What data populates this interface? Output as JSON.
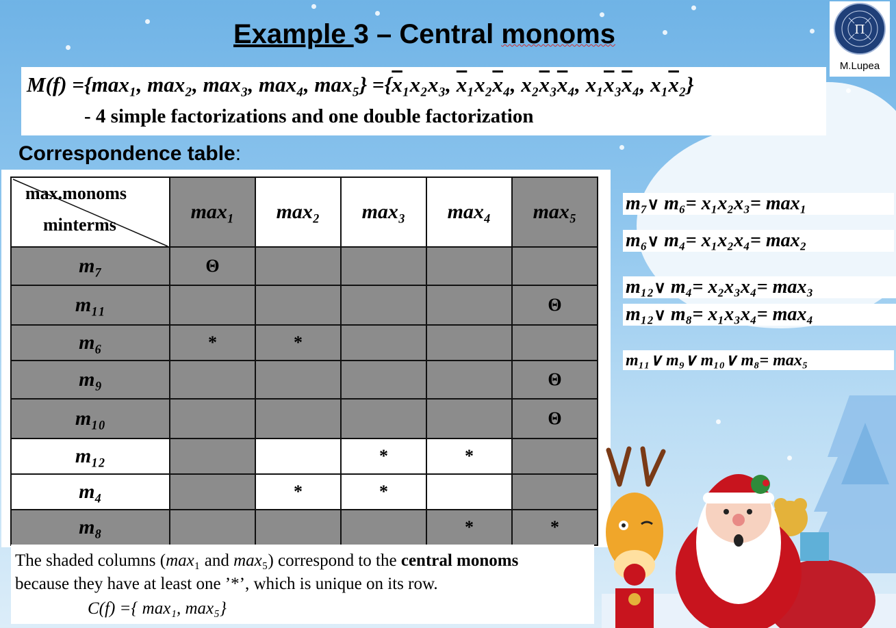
{
  "title": {
    "part1": "Example ",
    "part2": "3 – Central ",
    "part3": "monoms"
  },
  "logo": {
    "caption": "M.Lupea",
    "icon": "university-seal-icon"
  },
  "mset": {
    "lhs": "M(f) =",
    "set1": "{max₁, max₂, max₃, max₄, max₅}",
    "eq": " =",
    "set2_open": "{",
    "t1a": "x",
    "t1": "₁x₂x₃, ",
    "t2a": "x",
    "t2b": "₁x₂",
    "t2c": "x",
    "t2d": "₄, ",
    "t3a": "x₂",
    "t3b": "x",
    "t3c": "₃",
    "t3d": "x",
    "t3e": "₄, ",
    "t4a": "x₁",
    "t4b": "x",
    "t4c": "₃",
    "t4d": "x",
    "t4e": "₄, ",
    "t5a": "x₁",
    "t5b": "x",
    "t5c": "₂}",
    "subtitle": "- 4 simple factorizations and one double factorization"
  },
  "correspondence": {
    "label": "Correspondence table",
    "colon": ":"
  },
  "table": {
    "header_top": "max.monoms",
    "header_bottom": "minterms",
    "columns": [
      "max₁",
      "max₂",
      "max₃",
      "max₄",
      "max₅"
    ],
    "rows": [
      {
        "label": "m₇",
        "cells": [
          "Θ",
          "",
          "",
          "",
          ""
        ]
      },
      {
        "label": "m₁₁",
        "cells": [
          "",
          "",
          "",
          "",
          "Θ"
        ]
      },
      {
        "label": "m₆",
        "cells": [
          "*",
          "*",
          "",
          "",
          ""
        ]
      },
      {
        "label": "m₉",
        "cells": [
          "",
          "",
          "",
          "",
          "Θ"
        ]
      },
      {
        "label": "m₁₀",
        "cells": [
          "",
          "",
          "",
          "",
          "Θ"
        ]
      },
      {
        "label": "m₁₂",
        "cells": [
          "",
          "",
          "*",
          "*",
          ""
        ]
      },
      {
        "label": "m₄",
        "cells": [
          "",
          "*",
          "*",
          "",
          ""
        ]
      },
      {
        "label": "m₈",
        "cells": [
          "",
          "",
          "",
          "*",
          "*"
        ]
      }
    ],
    "shade_color": "#8c8c8c"
  },
  "note": {
    "l1a": "The shaded columns (",
    "l1b": "max",
    "l1c": "₁",
    "l1d": " and ",
    "l1e": "max",
    "l1f": "₅",
    "l1g": ") correspond to the ",
    "l1h": "central monoms",
    "l2": "because they have at least one ’*’, which is unique on its row.",
    "l3": "C(f) ={ max₁, max₅}"
  },
  "equations": [
    {
      "lhs": "m₇",
      "or": "∨",
      "mid": " m₆= x₁x₂x₃= max₁"
    },
    {
      "lhs": "m₆",
      "or": "∨",
      "mid": " m₄= x₁x₂x₄= max₂"
    },
    {
      "lhs": "m₁₂",
      "or": "∨",
      "mid": " m₄= x₂x₃x₄= max₃"
    },
    {
      "lhs": "m₁₂",
      "or": "∨",
      "mid": " m₈= x₁x₃x₄= max₄"
    },
    {
      "lhs": "m₁₁∨ m₉∨ m₁₀∨ m₈",
      "or": "=",
      "mid": " max₅"
    }
  ]
}
